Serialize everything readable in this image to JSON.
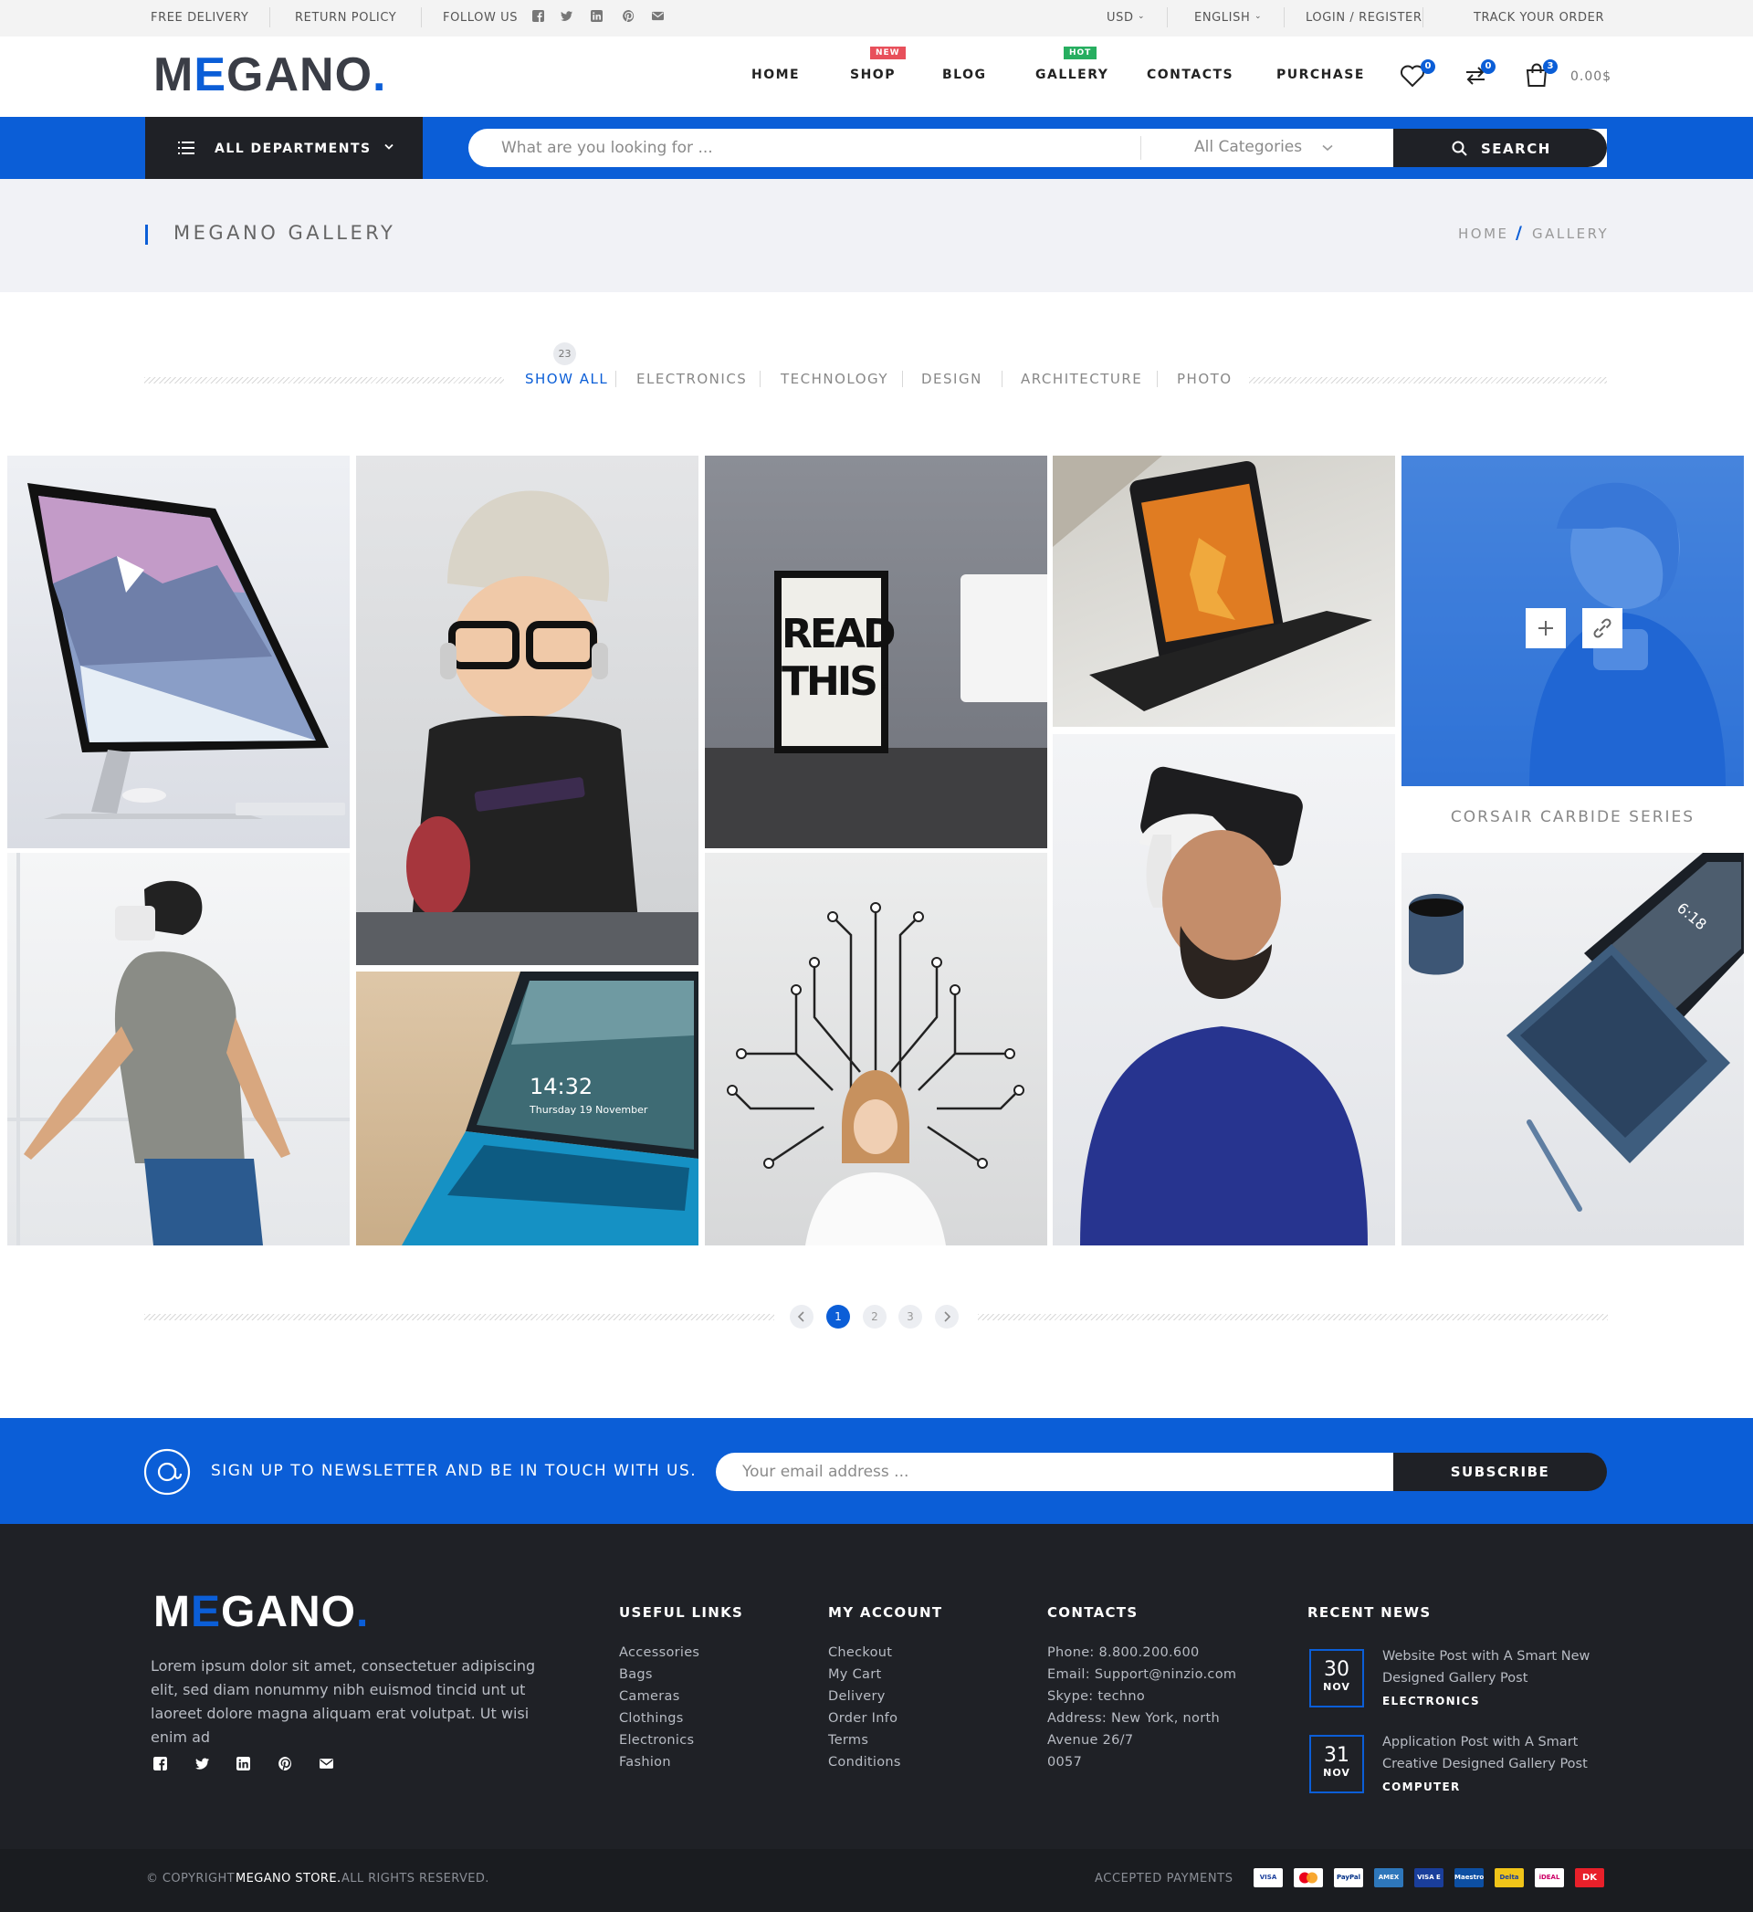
{
  "colors": {
    "brand": "#0b5ed7",
    "dark": "#1f2126",
    "new": "#e8505b",
    "hot": "#27ae60"
  },
  "topbar": {
    "free_delivery": "FREE DELIVERY",
    "return_policy": "RETURN POLICY",
    "follow_us": "FOLLOW US",
    "social_icons": [
      "facebook-icon",
      "twitter-icon",
      "linkedin-icon",
      "pinterest-icon",
      "mail-icon"
    ],
    "currency": "USD",
    "language": "ENGLISH",
    "login": "LOGIN / REGISTER",
    "track": "TRACK YOUR ORDER"
  },
  "header": {
    "logo_m": "M",
    "logo_e": "E",
    "logo_rest": "GANO",
    "logo_dot": ".",
    "nav": [
      "HOME",
      "SHOP",
      "BLOG",
      "GALLERY",
      "CONTACTS",
      "PURCHASE"
    ],
    "tag_new": "NEW",
    "tag_hot": "HOT",
    "wishlist_count": "0",
    "compare_count": "0",
    "cart_count": "3",
    "cart_total": "0.00$"
  },
  "searchbar": {
    "departments": "ALL DEPARTMENTS",
    "placeholder": "What are you looking for ...",
    "categories": "All Categories",
    "search": "SEARCH"
  },
  "pagehead": {
    "title": "MEGANO GALLERY",
    "crumb_home": "HOME",
    "crumb_sep": "/",
    "crumb_current": "GALLERY"
  },
  "filters": {
    "count": "23",
    "items": [
      "SHOW ALL",
      "ELECTRONICS",
      "TECHNOLOGY",
      "DESIGN",
      "ARCHITECTURE",
      "PHOTO"
    ]
  },
  "gallery": {
    "hover_caption": "CORSAIR CARBIDE SERIES",
    "poster_line1": "READ",
    "poster_line2": "THIS!",
    "laptop_time": "14:32",
    "laptop_date": "Thursday 19 November",
    "tablet_time": "6:18"
  },
  "pagination": {
    "pages": [
      "1",
      "2",
      "3"
    ],
    "active": "1"
  },
  "newsletter": {
    "text": "SIGN UP TO NEWSLETTER AND BE IN TOUCH WITH US.",
    "placeholder": "Your email address ...",
    "button": "SUBSCRIBE"
  },
  "footer": {
    "about": "Lorem ipsum dolor sit amet, consectetuer adipiscing elit, sed diam nonummy nibh euismod tincid  unt ut laoreet dolore magna aliquam erat volutpat. Ut wisi enim ad",
    "useful_links_title": "USEFUL LINKS",
    "useful_links": [
      "Accessories",
      "Bags",
      "Cameras",
      "Clothings",
      "Electronics",
      "Fashion"
    ],
    "account_title": "MY ACCOUNT",
    "account_links": [
      "Checkout",
      "My Cart",
      "Delivery",
      "Order Info",
      "Terms",
      "Conditions"
    ],
    "contacts_title": "CONTACTS",
    "contacts": [
      "Phone: 8.800.200.600",
      "Email: Support@ninzio.com",
      "Skype: techno",
      "Address: New York, north",
      "Avenue 26/7",
      "0057"
    ],
    "news_title": "RECENT NEWS",
    "news": [
      {
        "day": "30",
        "month": "NOV",
        "title": "Website Post with A Smart New Designed Gallery Post",
        "category": "ELECTRONICS"
      },
      {
        "day": "31",
        "month": "NOV",
        "title": "Application Post with A Smart Creative Designed Gallery Post",
        "category": "COMPUTER"
      }
    ]
  },
  "bottom": {
    "copyright_prefix": "© COPYRIGHT",
    "store": "MEGANO STORE.",
    "copyright_suffix": "ALL RIGHTS RESERVED.",
    "accepted": "ACCEPTED PAYMENTS",
    "payments": [
      "VISA",
      "MC",
      "PayPal",
      "AMEX",
      "VISA E",
      "Maestro",
      "Delta",
      "iDEAL",
      "DK"
    ]
  }
}
